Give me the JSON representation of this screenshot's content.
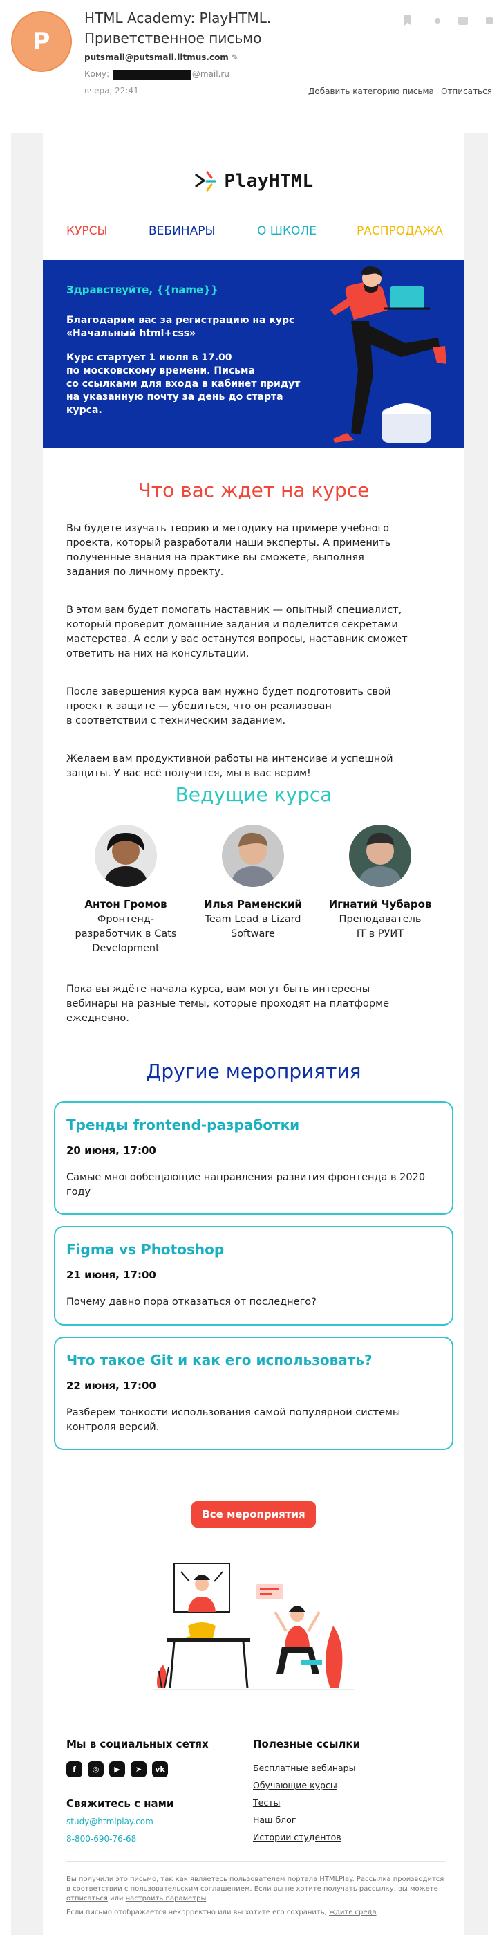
{
  "mail": {
    "avatar_letter": "P",
    "subject": "HTML Academy: PlayHTML. Приветственное письмо",
    "sender": "putsmail@putsmail.litmus.com",
    "to_label": "Кому:",
    "to_domain": "@mail.ru",
    "time": "вчера, 22:41",
    "add_category": "Добавить категорию письма",
    "unsubscribe": "Отписаться"
  },
  "email": {
    "logo_text": "PlayHTML",
    "nav": [
      {
        "label": "КУРСЫ",
        "color": "#f0473a"
      },
      {
        "label": "ВЕБИНАРЫ",
        "color": "#0b31a5"
      },
      {
        "label": "О ШКОЛЕ",
        "color": "#1ab0c0"
      },
      {
        "label": "РАСПРОДАЖА",
        "color": "#f5b800"
      }
    ],
    "hero": {
      "greeting": "Здравствуйте, {{name}}",
      "p1": "Благодарим вас за регистрацию на курс\n«Начальный html+css»",
      "p2": "Курс стартует 1 июля в 17.00\nпо московскому времени. Письма\nсо ссылками для входа в кабинет придут\nна указанную почту за день до старта\nкурса."
    },
    "expect": {
      "title": "Что вас ждет на курсе",
      "paragraphs": [
        "Вы будете изучать теорию и методику на примере учебного\nпроекта, который разработали наши эксперты. А применить\nполученные знания на практике вы сможете, выполняя\nзадания по личному проекту.",
        "В этом вам будет помогать наставник — опытный специалист,\nкоторый проверит домашние задания и поделится секретами\nмастерства. А если у вас останутся вопросы, наставник сможет\nответить на них на консультации.",
        "После завершения курса вам нужно будет подготовить свой\nпроект к защите — убедиться, что он реализован\nв соответствии с техническим заданием.",
        "Желаем вам продуктивной работы на интенсиве и успешной\nзащиты. У вас всё получится, мы в вас верим!"
      ]
    },
    "teachers": {
      "title": "Ведущие курса",
      "items": [
        {
          "name": "Антон Громов",
          "role": "Фронтенд-\nразработчик в Cats\nDevelopment"
        },
        {
          "name": "Илья Раменский",
          "role": "Team Lead в Lizard\nSoftware"
        },
        {
          "name": "Игнатий Чубаров",
          "role": "Преподаватель\nIT в РУИТ"
        }
      ]
    },
    "webinars_note": "Пока вы ждёте начала курса, вам могут быть интересны\nвебинары на разные темы, которые проходят на платформе\nежедневно.",
    "events": {
      "title": "Другие мероприятия",
      "items": [
        {
          "title": "Тренды frontend-разработки",
          "date": "20 июня, 17:00",
          "text": "Самые многообещающие направления развития фронтенда в 2020 году"
        },
        {
          "title": "Figma vs Photoshop",
          "date": "21 июня, 17:00",
          "text": "Почему давно пора отказаться от последнего?"
        },
        {
          "title": "Что такое Git и как его использовать?",
          "date": "22 июня, 17:00",
          "text": "Разберем тонкости использования самой популярной системы контроля версий."
        }
      ],
      "all_button": "Все мероприятия"
    },
    "footer": {
      "social_title": "Мы в социальных сетях",
      "social_icons": [
        "facebook-icon",
        "instagram-icon",
        "youtube-icon",
        "telegram-icon",
        "vk-icon"
      ],
      "contact_title": "Свяжитесь с нами",
      "email": "study@htmlplay.com",
      "phone": "8-800-690-76-68",
      "links_title": "Полезные ссылки",
      "links": [
        "Бесплатные вебинары",
        "Обучающие курсы",
        "Тесты",
        "Наш блог",
        "Истории студентов"
      ]
    },
    "legal": {
      "text1": "Вы получили это письмо, так как являетесь пользователем портала HTMLPlay. Рассылка производится в соответствии с пользовательским соглашением. Если вы не хотите получать рассылку, вы можете ",
      "unsubscribe": "отписаться",
      "or": " или ",
      "settings": "настроить параметры",
      "text2": "Если письмо отображается некорректно или вы хотите его сохранить, ",
      "online": "ждите среда"
    }
  },
  "colors": {
    "brand_blue": "#0b31a5",
    "brand_red": "#f0473a",
    "brand_teal": "#1ab0c0",
    "brand_yellow": "#f5b800"
  }
}
